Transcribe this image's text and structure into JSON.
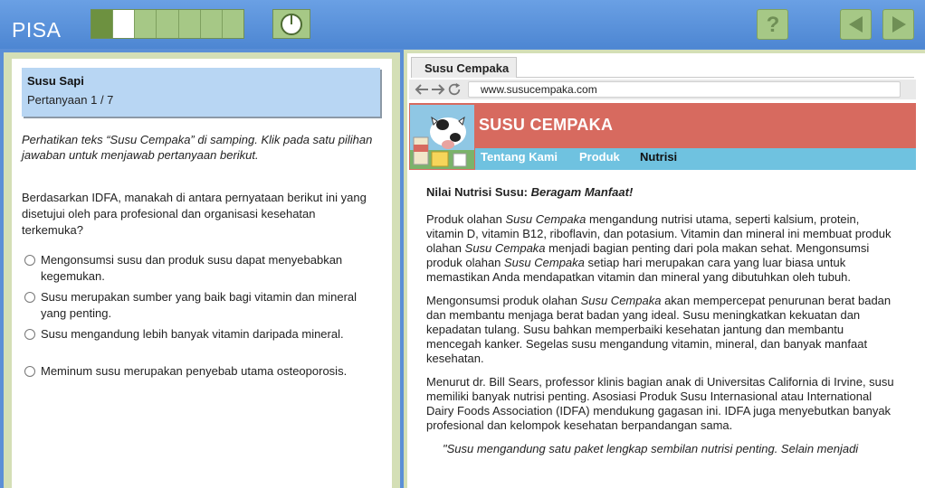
{
  "app": {
    "brand": "PISA"
  },
  "progress": {
    "total": 7,
    "done": 1,
    "current": 2
  },
  "left": {
    "unit_title": "Susu Sapi",
    "question_number": "Pertanyaan 1 / 7",
    "instruction": "Perhatikan teks “Susu Cempaka” di samping. Klik pada satu pilihan jawaban untuk menjawab pertanyaan berikut.",
    "question": "Berdasarkan IDFA, manakah di antara pernyataan berikut ini yang disetujui oleh para profesional dan organisasi kesehatan terkemuka?",
    "options": [
      "Mengonsumsi susu dan produk susu dapat menyebabkan kegemukan.",
      "Susu merupakan sumber yang baik bagi vitamin dan mineral yang penting.",
      "Susu mengandung lebih banyak vitamin daripada mineral.",
      "Meminum susu merupakan penyebab utama osteoporosis."
    ]
  },
  "browser": {
    "tab_label": "Susu Cempaka",
    "url": "www.susucempaka.com"
  },
  "site": {
    "title": "SUSU CEMPAKA",
    "nav": [
      "Tentang Kami",
      "Produk",
      "Nutrisi"
    ],
    "heading_prefix": "Nilai Nutrisi Susu: ",
    "heading_em": "Beragam Manfaat!",
    "brand_name": "Susu Cempaka",
    "p1_a": "Produk olahan ",
    "p1_b": " mengandung nutrisi utama, seperti kalsium, protein, vitamin D, vitamin B12, riboflavin, dan potasium. Vitamin dan mineral ini membuat produk olahan ",
    "p1_c": " menjadi bagian penting dari pola makan sehat. Mengonsumsi produk olahan ",
    "p1_d": " setiap hari merupakan cara yang luar biasa untuk memastikan Anda mendapatkan vitamin dan mineral yang dibutuhkan oleh tubuh.",
    "p2_a": "Mengonsumsi produk olahan ",
    "p2_b": " akan mempercepat penurunan berat badan dan membantu menjaga berat badan yang ideal. Susu meningkatkan kekuatan dan kepadatan tulang. Susu bahkan memperbaiki kesehatan jantung dan membantu mencegah kanker. Segelas susu mengandung vitamin, mineral, dan banyak manfaat kesehatan.",
    "p3": "Menurut dr. Bill Sears, professor klinis bagian anak di Universitas California di Irvine, susu memiliki banyak nutrisi penting. Asosiasi Produk Susu Internasional atau International Dairy Foods Association (IDFA) mendukung gagasan ini. IDFA juga menyebutkan banyak profesional dan kelompok kesehatan berpandangan sama.",
    "quote": "\"Susu mengandung satu paket lengkap sembilan nutrisi penting. Selain menjadi"
  },
  "colors": {
    "topbar": "#5b8fd6",
    "button_green": "#a6c886",
    "site_header": "#d76a5f",
    "site_nav": "#6fc2e0",
    "question_box": "#b8d6f3"
  },
  "icons": [
    "timer-icon",
    "help-icon",
    "back-arrow-icon",
    "next-arrow-icon",
    "browser-back-icon",
    "browser-forward-icon",
    "refresh-icon",
    "cow-logo-icon"
  ]
}
